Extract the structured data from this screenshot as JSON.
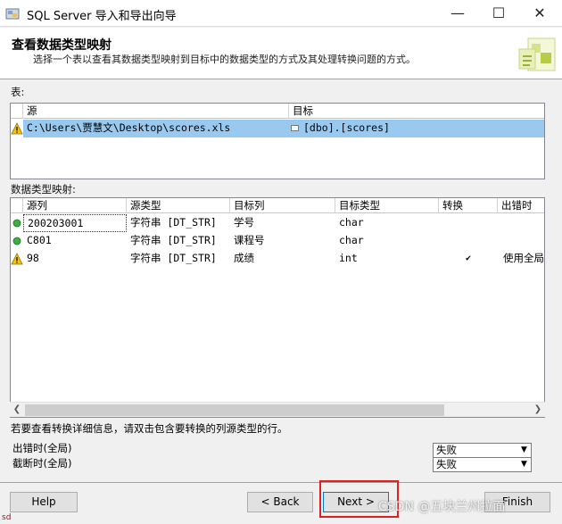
{
  "window": {
    "title": "SQL Server 导入和导出向导",
    "minimize": "—",
    "maximize": "☐",
    "close": "✕"
  },
  "header": {
    "title": "查看数据类型映射",
    "subtitle": "选择一个表以查看其数据类型映射到目标中的数据类型的方式及其处理转换问题的方式。"
  },
  "tables_section": {
    "label": "表:",
    "columns": [
      "源",
      "目标"
    ],
    "rows": [
      {
        "source": "C:\\Users\\贾慧文\\Desktop\\scores.xls",
        "target": "[dbo].[scores]",
        "status": "warning",
        "selected": true
      }
    ]
  },
  "mapping_section": {
    "label": "数据类型映射:",
    "columns": [
      "源列",
      "源类型",
      "目标列",
      "目标类型",
      "转换",
      "出错时"
    ],
    "rows": [
      {
        "source_col": "200203001",
        "source_type": "字符串 [DT_STR]",
        "target_col": "学号",
        "target_type": "char",
        "convert": false,
        "on_error": "",
        "status": "ok"
      },
      {
        "source_col": "C801",
        "source_type": "字符串 [DT_STR]",
        "target_col": "课程号",
        "target_type": "char",
        "convert": false,
        "on_error": "",
        "status": "ok"
      },
      {
        "source_col": "98",
        "source_type": "字符串 [DT_STR]",
        "target_col": "成绩",
        "target_type": "int",
        "convert": true,
        "on_error": "使用全局",
        "status": "warning"
      }
    ]
  },
  "hint": "若要查看转换详细信息，请双击包含要转换的列源类型的行。",
  "global_options": {
    "on_error_label": "出错时(全局)",
    "on_error_value": "失败",
    "on_truncate_label": "截断时(全局)",
    "on_truncate_value": "失败"
  },
  "buttons": {
    "help": "Help",
    "back": "< Back",
    "next": "Next >",
    "finish": "Finish"
  },
  "watermark": "CSDN @五块兰州拉面",
  "corner_text": "sd",
  "colors": {
    "selection": "#99c9ef",
    "highlight": "#e02020"
  }
}
